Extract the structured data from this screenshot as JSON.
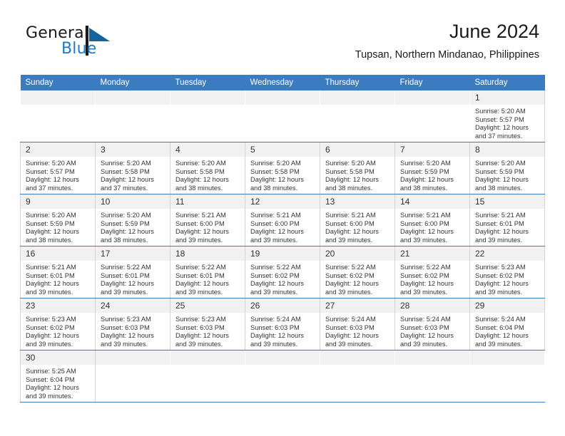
{
  "brand": {
    "name_part1": "General",
    "name_part2": "Blue",
    "flag_icon": "blue-triangle-flag-icon",
    "accent_color": "#1c7bc4"
  },
  "header": {
    "title": "June 2024",
    "subtitle": "Tupsan, Northern Mindanao, Philippines"
  },
  "theme": {
    "header_bg": "#3b7cc0",
    "header_text": "#ffffff",
    "daynum_bg": "#f1f1f1",
    "cell_border": "#d4d4d4",
    "row_divider": "#3b7cc0"
  },
  "calendar": {
    "weekday_headers": [
      "Sunday",
      "Monday",
      "Tuesday",
      "Wednesday",
      "Thursday",
      "Friday",
      "Saturday"
    ],
    "labels": {
      "sunrise": "Sunrise:",
      "sunset": "Sunset:",
      "daylight": "Daylight:"
    },
    "weeks": [
      [
        {
          "empty": true
        },
        {
          "empty": true
        },
        {
          "empty": true
        },
        {
          "empty": true
        },
        {
          "empty": true
        },
        {
          "empty": true
        },
        {
          "day": "1",
          "sunrise": "Sunrise: 5:20 AM",
          "sunset": "Sunset: 5:57 PM",
          "daylight_line1": "Daylight: 12 hours",
          "daylight_line2": "and 37 minutes."
        }
      ],
      [
        {
          "day": "2",
          "sunrise": "Sunrise: 5:20 AM",
          "sunset": "Sunset: 5:57 PM",
          "daylight_line1": "Daylight: 12 hours",
          "daylight_line2": "and 37 minutes."
        },
        {
          "day": "3",
          "sunrise": "Sunrise: 5:20 AM",
          "sunset": "Sunset: 5:58 PM",
          "daylight_line1": "Daylight: 12 hours",
          "daylight_line2": "and 37 minutes."
        },
        {
          "day": "4",
          "sunrise": "Sunrise: 5:20 AM",
          "sunset": "Sunset: 5:58 PM",
          "daylight_line1": "Daylight: 12 hours",
          "daylight_line2": "and 38 minutes."
        },
        {
          "day": "5",
          "sunrise": "Sunrise: 5:20 AM",
          "sunset": "Sunset: 5:58 PM",
          "daylight_line1": "Daylight: 12 hours",
          "daylight_line2": "and 38 minutes."
        },
        {
          "day": "6",
          "sunrise": "Sunrise: 5:20 AM",
          "sunset": "Sunset: 5:58 PM",
          "daylight_line1": "Daylight: 12 hours",
          "daylight_line2": "and 38 minutes."
        },
        {
          "day": "7",
          "sunrise": "Sunrise: 5:20 AM",
          "sunset": "Sunset: 5:59 PM",
          "daylight_line1": "Daylight: 12 hours",
          "daylight_line2": "and 38 minutes."
        },
        {
          "day": "8",
          "sunrise": "Sunrise: 5:20 AM",
          "sunset": "Sunset: 5:59 PM",
          "daylight_line1": "Daylight: 12 hours",
          "daylight_line2": "and 38 minutes."
        }
      ],
      [
        {
          "day": "9",
          "sunrise": "Sunrise: 5:20 AM",
          "sunset": "Sunset: 5:59 PM",
          "daylight_line1": "Daylight: 12 hours",
          "daylight_line2": "and 38 minutes."
        },
        {
          "day": "10",
          "sunrise": "Sunrise: 5:20 AM",
          "sunset": "Sunset: 5:59 PM",
          "daylight_line1": "Daylight: 12 hours",
          "daylight_line2": "and 38 minutes."
        },
        {
          "day": "11",
          "sunrise": "Sunrise: 5:21 AM",
          "sunset": "Sunset: 6:00 PM",
          "daylight_line1": "Daylight: 12 hours",
          "daylight_line2": "and 39 minutes."
        },
        {
          "day": "12",
          "sunrise": "Sunrise: 5:21 AM",
          "sunset": "Sunset: 6:00 PM",
          "daylight_line1": "Daylight: 12 hours",
          "daylight_line2": "and 39 minutes."
        },
        {
          "day": "13",
          "sunrise": "Sunrise: 5:21 AM",
          "sunset": "Sunset: 6:00 PM",
          "daylight_line1": "Daylight: 12 hours",
          "daylight_line2": "and 39 minutes."
        },
        {
          "day": "14",
          "sunrise": "Sunrise: 5:21 AM",
          "sunset": "Sunset: 6:00 PM",
          "daylight_line1": "Daylight: 12 hours",
          "daylight_line2": "and 39 minutes."
        },
        {
          "day": "15",
          "sunrise": "Sunrise: 5:21 AM",
          "sunset": "Sunset: 6:01 PM",
          "daylight_line1": "Daylight: 12 hours",
          "daylight_line2": "and 39 minutes."
        }
      ],
      [
        {
          "day": "16",
          "sunrise": "Sunrise: 5:21 AM",
          "sunset": "Sunset: 6:01 PM",
          "daylight_line1": "Daylight: 12 hours",
          "daylight_line2": "and 39 minutes."
        },
        {
          "day": "17",
          "sunrise": "Sunrise: 5:22 AM",
          "sunset": "Sunset: 6:01 PM",
          "daylight_line1": "Daylight: 12 hours",
          "daylight_line2": "and 39 minutes."
        },
        {
          "day": "18",
          "sunrise": "Sunrise: 5:22 AM",
          "sunset": "Sunset: 6:01 PM",
          "daylight_line1": "Daylight: 12 hours",
          "daylight_line2": "and 39 minutes."
        },
        {
          "day": "19",
          "sunrise": "Sunrise: 5:22 AM",
          "sunset": "Sunset: 6:02 PM",
          "daylight_line1": "Daylight: 12 hours",
          "daylight_line2": "and 39 minutes."
        },
        {
          "day": "20",
          "sunrise": "Sunrise: 5:22 AM",
          "sunset": "Sunset: 6:02 PM",
          "daylight_line1": "Daylight: 12 hours",
          "daylight_line2": "and 39 minutes."
        },
        {
          "day": "21",
          "sunrise": "Sunrise: 5:22 AM",
          "sunset": "Sunset: 6:02 PM",
          "daylight_line1": "Daylight: 12 hours",
          "daylight_line2": "and 39 minutes."
        },
        {
          "day": "22",
          "sunrise": "Sunrise: 5:23 AM",
          "sunset": "Sunset: 6:02 PM",
          "daylight_line1": "Daylight: 12 hours",
          "daylight_line2": "and 39 minutes."
        }
      ],
      [
        {
          "day": "23",
          "sunrise": "Sunrise: 5:23 AM",
          "sunset": "Sunset: 6:02 PM",
          "daylight_line1": "Daylight: 12 hours",
          "daylight_line2": "and 39 minutes."
        },
        {
          "day": "24",
          "sunrise": "Sunrise: 5:23 AM",
          "sunset": "Sunset: 6:03 PM",
          "daylight_line1": "Daylight: 12 hours",
          "daylight_line2": "and 39 minutes."
        },
        {
          "day": "25",
          "sunrise": "Sunrise: 5:23 AM",
          "sunset": "Sunset: 6:03 PM",
          "daylight_line1": "Daylight: 12 hours",
          "daylight_line2": "and 39 minutes."
        },
        {
          "day": "26",
          "sunrise": "Sunrise: 5:24 AM",
          "sunset": "Sunset: 6:03 PM",
          "daylight_line1": "Daylight: 12 hours",
          "daylight_line2": "and 39 minutes."
        },
        {
          "day": "27",
          "sunrise": "Sunrise: 5:24 AM",
          "sunset": "Sunset: 6:03 PM",
          "daylight_line1": "Daylight: 12 hours",
          "daylight_line2": "and 39 minutes."
        },
        {
          "day": "28",
          "sunrise": "Sunrise: 5:24 AM",
          "sunset": "Sunset: 6:03 PM",
          "daylight_line1": "Daylight: 12 hours",
          "daylight_line2": "and 39 minutes."
        },
        {
          "day": "29",
          "sunrise": "Sunrise: 5:24 AM",
          "sunset": "Sunset: 6:04 PM",
          "daylight_line1": "Daylight: 12 hours",
          "daylight_line2": "and 39 minutes."
        }
      ],
      [
        {
          "day": "30",
          "sunrise": "Sunrise: 5:25 AM",
          "sunset": "Sunset: 6:04 PM",
          "daylight_line1": "Daylight: 12 hours",
          "daylight_line2": "and 39 minutes."
        },
        {
          "empty": true
        },
        {
          "empty": true
        },
        {
          "empty": true
        },
        {
          "empty": true
        },
        {
          "empty": true
        },
        {
          "empty": true
        }
      ]
    ]
  }
}
